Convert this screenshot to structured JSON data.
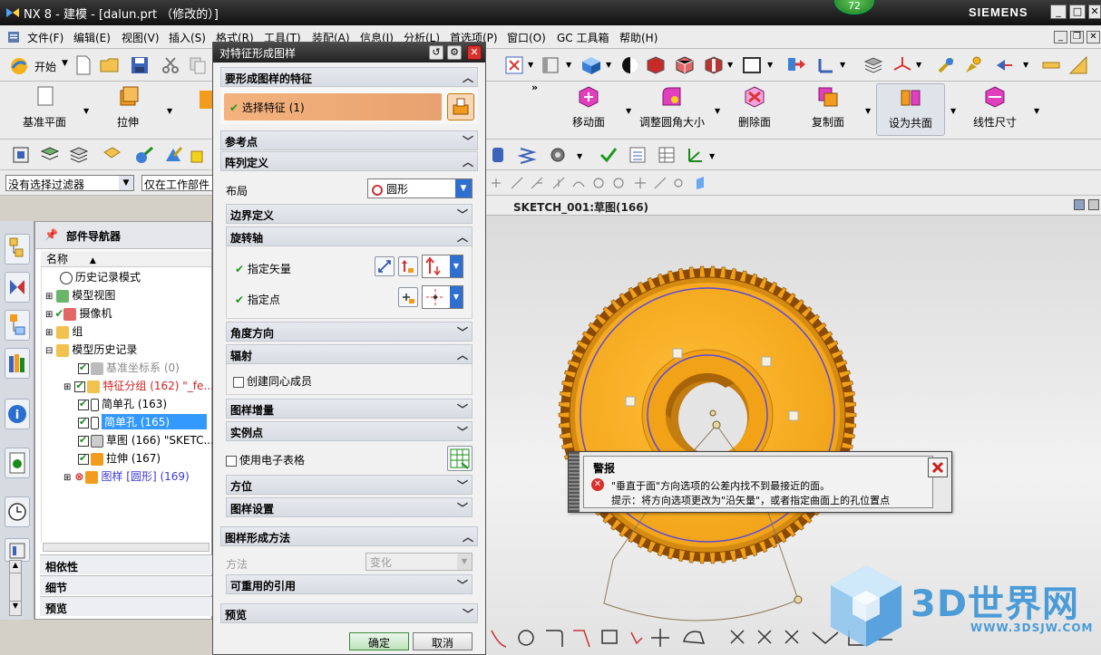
{
  "window": {
    "title": "NX 8 - 建模 - [dalun.prt （修改的）]",
    "brand": "SIEMENS",
    "badge": "72"
  },
  "menu": [
    "文件(F)",
    "编辑(E)",
    "视图(V)",
    "插入(S)",
    "格式(R)",
    "工具(T)",
    "装配(A)",
    "信息(I)",
    "分析(L)",
    "首选项(P)",
    "窗口(O)",
    "GC 工具箱",
    "帮助(H)"
  ],
  "toolbar": {
    "start_label": "开始",
    "datum_plane": "基准平面",
    "extrude": "拉伸",
    "move_face": "移动面",
    "resize_blend": "调整圆角大小",
    "delete_face": "删除面",
    "copy_face": "复制面",
    "make_coplanar": "设为共面",
    "linear_dimension": "线性尺寸"
  },
  "filters": {
    "selection_filter": "没有选择过滤器",
    "scope": "仅在工作部件"
  },
  "graphics": {
    "tab_label": "SKETCH_001:草图(166)"
  },
  "part_navigator": {
    "title": "部件导航器",
    "column_name": "名称",
    "items": [
      {
        "label": "历史记录模式"
      },
      {
        "label": "模型视图"
      },
      {
        "label": "摄像机"
      },
      {
        "label": "组"
      },
      {
        "label": "模型历史记录"
      },
      {
        "label": "基准坐标系 (0)"
      },
      {
        "label": "特征分组 (162) \"_fe..."
      },
      {
        "label": "简单孔 (163)"
      },
      {
        "label": "简单孔 (165)"
      },
      {
        "label": "草图 (166) \"SKETC..."
      },
      {
        "label": "拉伸 (167)"
      },
      {
        "label": "图样 [圆形] (169)"
      }
    ],
    "sections": [
      "相依性",
      "细节",
      "预览"
    ]
  },
  "dialog": {
    "title": "对特征形成图样",
    "feature_group": "要形成图样的特征",
    "select_feature": "选择特征 (1)",
    "reference_point": "参考点",
    "array_definition": "阵列定义",
    "layout_label": "布局",
    "layout_value": "圆形",
    "boundary": "边界定义",
    "rotation_axis": "旋转轴",
    "specify_vector": "指定矢量",
    "specify_point": "指定点",
    "angle_direction": "角度方向",
    "radiate": "辐射",
    "create_concentric": "创建同心成员",
    "pattern_increment": "图样增量",
    "instance_point": "实例点",
    "use_spreadsheet": "使用电子表格",
    "orientation": "方位",
    "pattern_settings": "图样设置",
    "pattern_method": "图样形成方法",
    "method_label": "方法",
    "method_value": "变化",
    "reusable_refs": "可重用的引用",
    "preview": "预览",
    "ok": "确定",
    "cancel": "取消"
  },
  "alert": {
    "title": "警报",
    "line1": "\"垂直于面\"方向选项的公差内找不到最接近的面。",
    "line2": "提示：将方向选项更改为\"沿矢量\"，或者指定曲面上的孔位置点"
  },
  "watermark": {
    "text": "3D世界网",
    "url": "WWW.3DSJW.COM"
  }
}
